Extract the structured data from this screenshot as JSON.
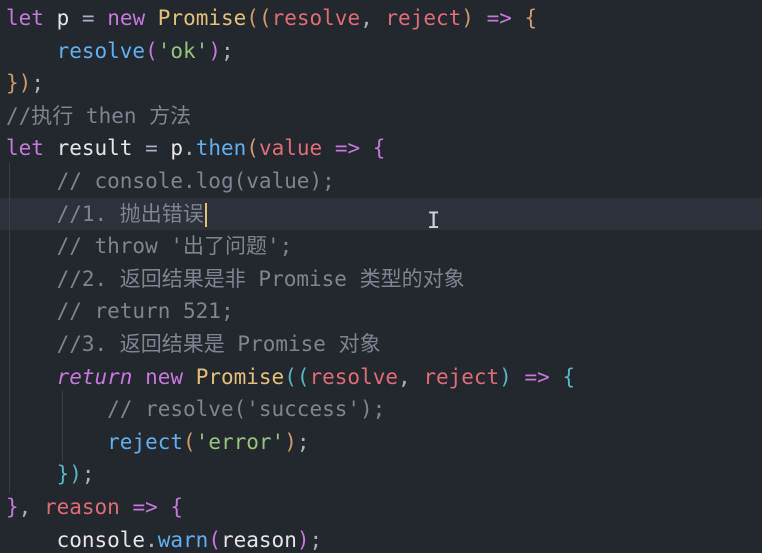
{
  "editor": {
    "lines": [
      {
        "tokens": [
          [
            "kw",
            "let"
          ],
          [
            "plain",
            " "
          ],
          [
            "var",
            "p"
          ],
          [
            "plain",
            " = "
          ],
          [
            "kw",
            "new"
          ],
          [
            "plain",
            " "
          ],
          [
            "cls",
            "Promise"
          ],
          [
            "pb",
            "(("
          ],
          [
            "par",
            "resolve"
          ],
          [
            "plain",
            ", "
          ],
          [
            "par",
            "reject"
          ],
          [
            "pb",
            ")"
          ],
          [
            "plain",
            " "
          ],
          [
            "kw",
            "=>"
          ],
          [
            "plain",
            " "
          ],
          [
            "pb",
            "{"
          ]
        ]
      },
      {
        "tokens": [
          [
            "plain",
            "    "
          ],
          [
            "fn",
            "resolve"
          ],
          [
            "pv",
            "("
          ],
          [
            "str",
            "'ok'"
          ],
          [
            "pv",
            ")"
          ],
          [
            "plain",
            ";"
          ]
        ]
      },
      {
        "tokens": [
          [
            "pb",
            "}"
          ],
          [
            "pb",
            ")"
          ],
          [
            "plain",
            ";"
          ]
        ]
      },
      {
        "tokens": [
          [
            "cmt",
            "//执行 then 方法"
          ]
        ]
      },
      {
        "tokens": [
          [
            "kw",
            "let"
          ],
          [
            "plain",
            " "
          ],
          [
            "var",
            "result"
          ],
          [
            "plain",
            " = "
          ],
          [
            "var",
            "p"
          ],
          [
            "plain",
            "."
          ],
          [
            "fn",
            "then"
          ],
          [
            "pb",
            "("
          ],
          [
            "par",
            "value"
          ],
          [
            "plain",
            " "
          ],
          [
            "kw",
            "=>"
          ],
          [
            "plain",
            " "
          ],
          [
            "pv",
            "{"
          ]
        ]
      },
      {
        "tokens": [
          [
            "plain",
            "    "
          ],
          [
            "cmt",
            "// console.log(value);"
          ]
        ]
      },
      {
        "tokens": [
          [
            "plain",
            "    "
          ],
          [
            "cmt",
            "//1. 抛出错误"
          ]
        ],
        "active": true
      },
      {
        "tokens": [
          [
            "plain",
            "    "
          ],
          [
            "cmt",
            "// throw '出了问题';"
          ]
        ]
      },
      {
        "tokens": [
          [
            "plain",
            "    "
          ],
          [
            "cmt",
            "//2. 返回结果是非 Promise 类型的对象"
          ]
        ]
      },
      {
        "tokens": [
          [
            "plain",
            "    "
          ],
          [
            "cmt",
            "// return 521;"
          ]
        ]
      },
      {
        "tokens": [
          [
            "plain",
            "    "
          ],
          [
            "cmt",
            "//3. 返回结果是 Promise 对象"
          ]
        ]
      },
      {
        "tokens": [
          [
            "plain",
            "    "
          ],
          [
            "kwi",
            "return"
          ],
          [
            "plain",
            " "
          ],
          [
            "kw",
            "new"
          ],
          [
            "plain",
            " "
          ],
          [
            "cls",
            "Promise"
          ],
          [
            "op",
            "(("
          ],
          [
            "par",
            "resolve"
          ],
          [
            "plain",
            ", "
          ],
          [
            "par",
            "reject"
          ],
          [
            "op",
            ")"
          ],
          [
            "plain",
            " "
          ],
          [
            "kw",
            "=>"
          ],
          [
            "plain",
            " "
          ],
          [
            "op",
            "{"
          ]
        ]
      },
      {
        "tokens": [
          [
            "plain",
            "        "
          ],
          [
            "cmt",
            "// resolve('success');"
          ]
        ]
      },
      {
        "tokens": [
          [
            "plain",
            "        "
          ],
          [
            "fn",
            "reject"
          ],
          [
            "pb",
            "("
          ],
          [
            "str",
            "'error'"
          ],
          [
            "pb",
            ")"
          ],
          [
            "plain",
            ";"
          ]
        ]
      },
      {
        "tokens": [
          [
            "plain",
            "    "
          ],
          [
            "op",
            "}"
          ],
          [
            "op",
            ")"
          ],
          [
            "plain",
            ";"
          ]
        ]
      },
      {
        "tokens": [
          [
            "pv",
            "}"
          ],
          [
            "plain",
            ", "
          ],
          [
            "par",
            "reason"
          ],
          [
            "plain",
            " "
          ],
          [
            "kw",
            "=>"
          ],
          [
            "plain",
            " "
          ],
          [
            "pv",
            "{"
          ]
        ]
      },
      {
        "tokens": [
          [
            "plain",
            "    "
          ],
          [
            "var",
            "console"
          ],
          [
            "plain",
            "."
          ],
          [
            "fn",
            "warn"
          ],
          [
            "pv",
            "("
          ],
          [
            "var",
            "reason"
          ],
          [
            "pv",
            ")"
          ],
          [
            "plain",
            ";"
          ]
        ]
      }
    ],
    "cursor_line": 6
  }
}
